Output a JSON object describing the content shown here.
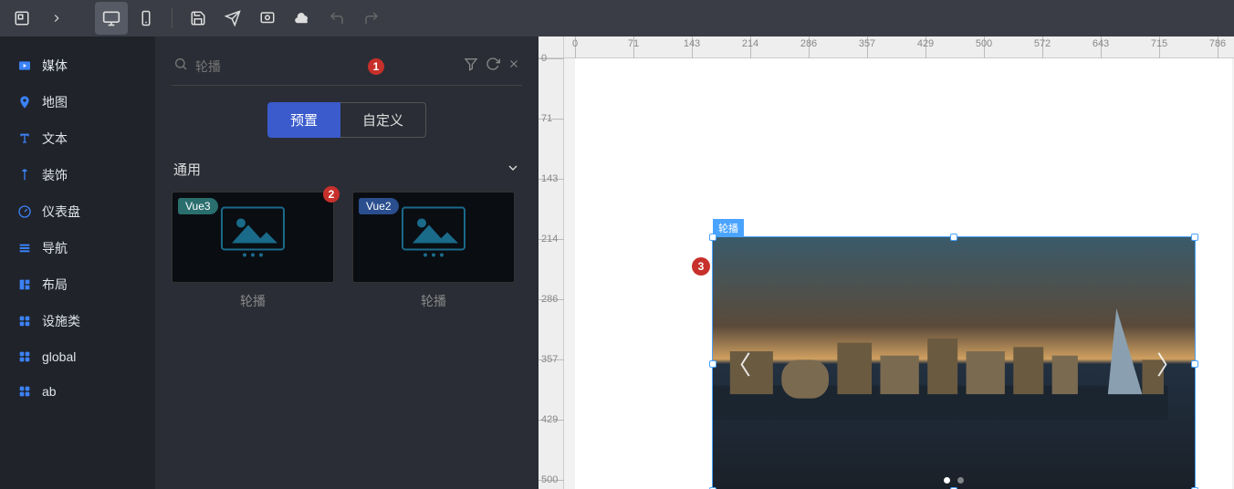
{
  "topbar": {
    "items": [
      "logo",
      "chevron",
      "desktop",
      "mobile",
      "sep",
      "save",
      "send",
      "preview",
      "cloud",
      "undo",
      "redo"
    ]
  },
  "leftnav": {
    "items": [
      {
        "icon": "play",
        "label": "媒体"
      },
      {
        "icon": "pin",
        "label": "地图"
      },
      {
        "icon": "text",
        "label": "文本"
      },
      {
        "icon": "decor",
        "label": "装饰"
      },
      {
        "icon": "gauge",
        "label": "仪表盘"
      },
      {
        "icon": "list",
        "label": "导航"
      },
      {
        "icon": "layout",
        "label": "布局"
      },
      {
        "icon": "apps",
        "label": "设施类"
      },
      {
        "icon": "apps",
        "label": "global"
      },
      {
        "icon": "apps",
        "label": "ab"
      }
    ]
  },
  "panel": {
    "search_placeholder": "轮播",
    "badge_search": "1",
    "tabs": {
      "preset": "预置",
      "custom": "自定义"
    },
    "group_title": "通用",
    "cards": [
      {
        "tag": "Vue3",
        "tag_cls": "v3",
        "label": "轮播",
        "badge": "2"
      },
      {
        "tag": "Vue2",
        "tag_cls": "v2",
        "label": "轮播"
      }
    ]
  },
  "canvas": {
    "h_ticks": [
      0,
      71,
      143,
      214,
      286,
      357,
      429,
      500,
      572,
      643,
      715,
      786
    ],
    "v_ticks": [
      0,
      71,
      143,
      214,
      286,
      357,
      429,
      500
    ],
    "component": {
      "tag": "轮播",
      "ann": "3"
    }
  }
}
